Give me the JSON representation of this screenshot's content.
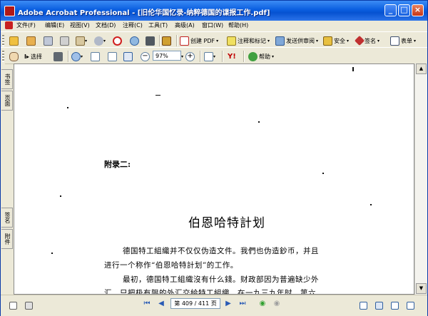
{
  "window": {
    "title": "Adobe Acrobat Professional - [旧伦华国忆录-纳粹德国的谍报工作.pdf]",
    "minimize": "_",
    "maximize": "□",
    "close": "×"
  },
  "menu": [
    "文件(F)",
    "编辑(E)",
    "视图(V)",
    "文档(D)",
    "注释(C)",
    "工具(T)",
    "高级(A)",
    "窗口(W)",
    "帮助(H)"
  ],
  "toolbar1": {
    "create_pdf": "创建 PDF",
    "comment_markup": "注释和标记",
    "send_review": "发送供审阅",
    "secure": "安全",
    "sign": "签名",
    "forms": "表单"
  },
  "toolbar2": {
    "select": "选择",
    "zoom_value": "97%",
    "help": "帮助"
  },
  "side_tabs": {
    "bookmarks": "书签",
    "pages": "页面",
    "signatures": "签名",
    "attachments": "附件"
  },
  "document": {
    "appendix": "附录二:",
    "title": "伯恩哈特計划",
    "lines": [
      "德国特工組織并不仅仅伪造文件。我們也伪造鈔币，并且",
      "进行一个称作“伯恩哈特計划”的工作。",
      "最初，德国特工組織沒有什么錢。财政部因为普遍缺少外",
      "汇，只把极有限的外汇交給特工組織，在一九三九年时，第六"
    ]
  },
  "status": {
    "page_indicator": "第 409 / 411 页"
  },
  "colors": {
    "titlebar": "#0a5ee0",
    "chrome": "#ece9d8",
    "nav_arrows": "#2a5bb5"
  }
}
